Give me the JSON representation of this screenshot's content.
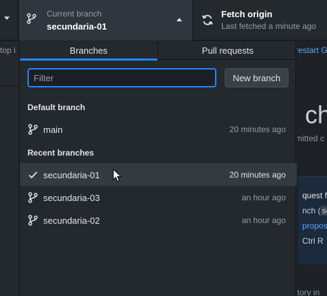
{
  "toolbar": {
    "current_branch": {
      "label": "Current branch",
      "value": "secundaria-01"
    },
    "fetch": {
      "label": "Fetch origin",
      "subtext": "Last fetched a minute ago"
    }
  },
  "background": {
    "sidebar_stub": "top i",
    "main_link": "restart G",
    "main_heading": "l ch",
    "main_sub": "mitted c",
    "card_line1": "quest fo",
    "card_line2_prefix": "nch (",
    "card_line2_code": "se",
    "card_line3": "propos",
    "card_line4": "Ctrl  R",
    "bottom_text": "itory in"
  },
  "popover": {
    "tabs": [
      {
        "label": "Branches"
      },
      {
        "label": "Pull requests"
      }
    ],
    "filter": {
      "placeholder": "Filter",
      "value": ""
    },
    "new_branch_label": "New branch",
    "default_section": "Default branch",
    "recent_section": "Recent branches",
    "default_branches": [
      {
        "name": "main",
        "time": "20 minutes ago"
      }
    ],
    "recent_branches": [
      {
        "name": "secundaria-01",
        "time": "20 minutes ago",
        "checked": true
      },
      {
        "name": "secundaria-03",
        "time": "an hour ago",
        "checked": false
      },
      {
        "name": "secundaria-02",
        "time": "an hour ago",
        "checked": false
      }
    ]
  },
  "colors": {
    "accent": "#2188ff",
    "bg": "#24292e",
    "selected_row": "#333a42"
  }
}
